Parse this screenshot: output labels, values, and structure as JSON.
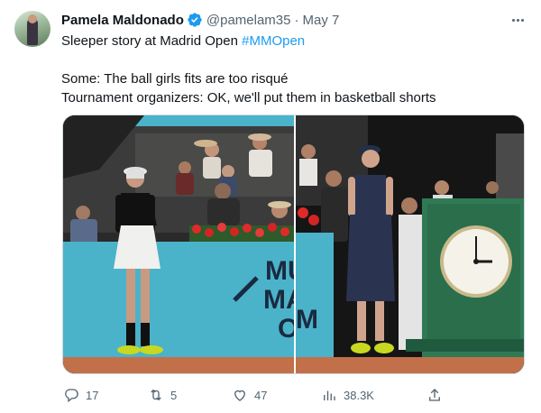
{
  "author": {
    "name": "Pamela Maldonado",
    "handle": "@pamelam35",
    "separator": "·",
    "date": "May 7",
    "verified": true
  },
  "tweet": {
    "line1_text": "Sleeper story at Madrid Open ",
    "hashtag": "#MMOpen",
    "line2": "Some: The ball girls fits are too risqué",
    "line3": "Tournament organizers: OK, we'll put them in basketball shorts"
  },
  "media": {
    "sign_text_1": "MU",
    "sign_text_2": "MA",
    "sign_text_3": "O",
    "sign_text_4": "M",
    "court_color": "#4ab3c9",
    "clay_color": "#c2704a",
    "clock_face_color": "#f5f2ea",
    "clock_case_color": "#2f7a55"
  },
  "actions": {
    "replies": "17",
    "retweets": "5",
    "likes": "47",
    "views": "38.3K"
  },
  "colors": {
    "accent": "#1d9bf0",
    "secondary_text": "#536471",
    "primary_text": "#0f1419"
  }
}
